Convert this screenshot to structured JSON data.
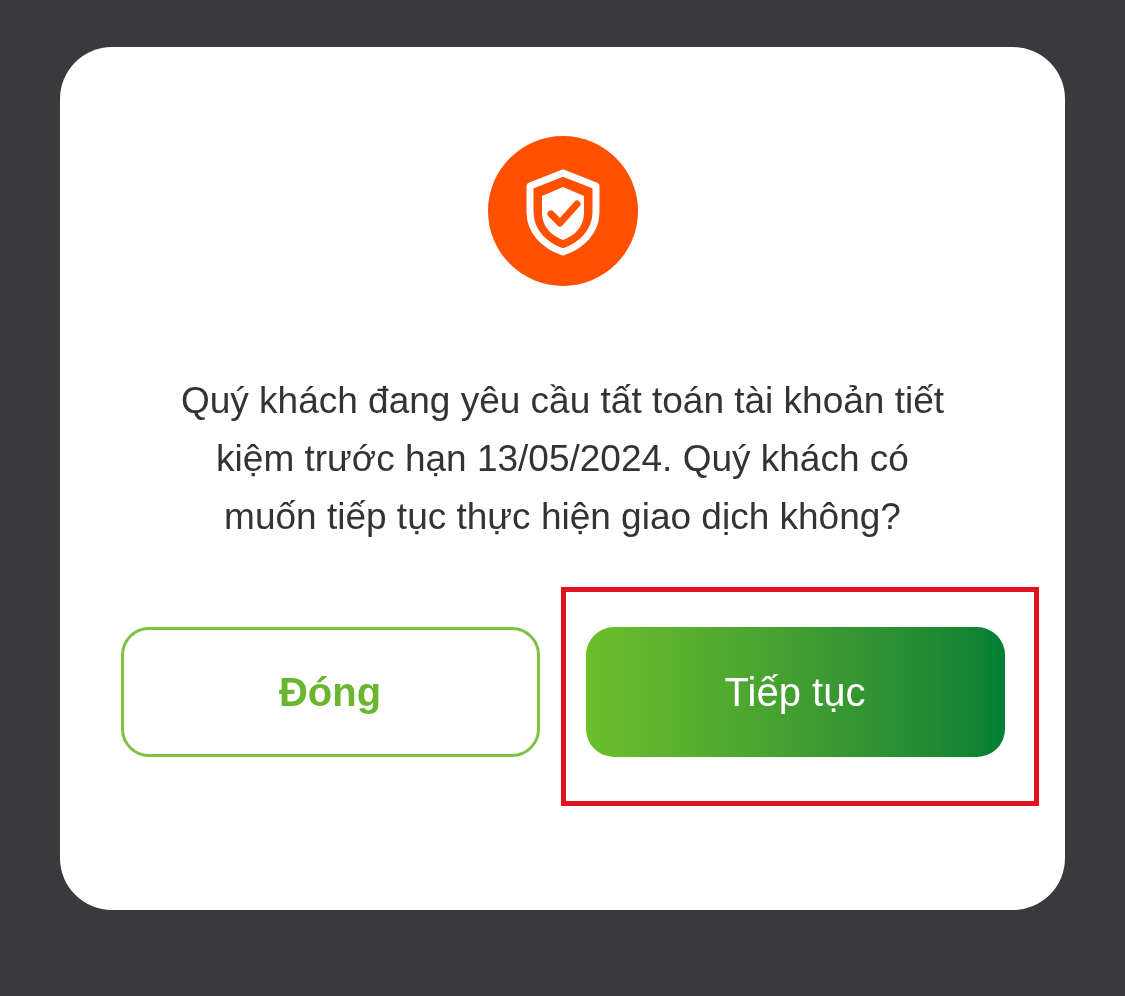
{
  "dialog": {
    "message": "Quý khách đang yêu cầu tất toán tài khoản tiết kiệm trước hạn 13/05/2024. Quý khách có muốn tiếp tục thực hiện giao dịch không?",
    "buttons": [
      {
        "label": "Đóng",
        "kind": "secondary",
        "highlighted": false
      },
      {
        "label": "Tiếp tục",
        "kind": "primary",
        "highlighted": true
      }
    ]
  }
}
